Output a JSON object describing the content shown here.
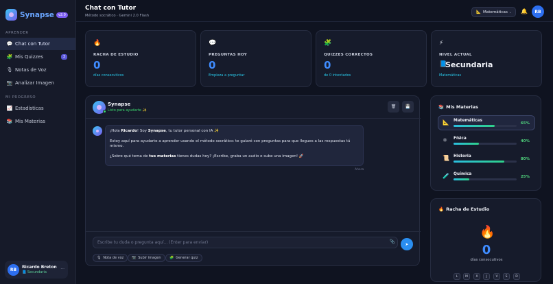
{
  "app": {
    "name": "Synapse",
    "version": "v2.0"
  },
  "sidebar": {
    "section_learn": "APRENDER",
    "section_progress": "MI PROGRESO",
    "items": [
      {
        "label": "Chat con Tutor",
        "icon": "chat-icon"
      },
      {
        "label": "Mis Quizzes",
        "icon": "quiz-icon",
        "badge": "3"
      },
      {
        "label": "Notas de Voz",
        "icon": "mic-icon"
      },
      {
        "label": "Analizar Imagen",
        "icon": "image-icon"
      },
      {
        "label": "Estadísticas",
        "icon": "chart-icon"
      },
      {
        "label": "Mis Materias",
        "icon": "books-icon"
      }
    ],
    "user": {
      "initials": "RB",
      "name": "Ricardo Breton",
      "level": "Secundaria"
    }
  },
  "header": {
    "title": "Chat con Tutor",
    "subtitle": "Método socrático · Gemini 2.0 Flash",
    "subject": "Matemáticas",
    "avatar": "RB"
  },
  "stats": [
    {
      "label": "RACHA DE ESTUDIO",
      "value": "0",
      "foot": "días consecutivos",
      "icon": "fire-icon"
    },
    {
      "label": "PREGUNTAS HOY",
      "value": "0",
      "foot": "Empieza a preguntar",
      "icon": "speech-icon"
    },
    {
      "label": "QUIZZES CORRECTOS",
      "value": "0",
      "foot": "de 0 intentados",
      "icon": "puzzle-icon"
    },
    {
      "label": "NIVEL ACTUAL",
      "value": "Secundaria",
      "foot": "Matemáticas",
      "icon": "bolt-icon"
    }
  ],
  "chat": {
    "bot_name": "Synapse",
    "bot_status": "Listo para ayudarte ✨",
    "message": {
      "p1_a": "¡Hola ",
      "p1_b": "Ricardo",
      "p1_c": "! Soy ",
      "p1_d": "Synapse",
      "p1_e": ", tu tutor personal con IA ✨",
      "p2": "Estoy aquí para ayudarte a aprender usando el método socrático: te guiaré con preguntas para que llegues a las respuestas tú mismo.",
      "p3_a": "¿Sobre qué tema de ",
      "p3_b": "tus materias",
      "p3_c": " tienes dudas hoy? ¡Escribe, graba un audio o sube una imagen! 🚀",
      "time": "Ahora"
    },
    "input_placeholder": "Escribe tu duda o pregunta aquí... (Enter para enviar)",
    "actions": [
      "Nota de voz",
      "Subir imagen",
      "Generar quiz"
    ]
  },
  "materias": {
    "title": "Mis Materias",
    "items": [
      {
        "name": "Matemáticas",
        "percent": 65,
        "label": "65%",
        "icon": "ruler-icon"
      },
      {
        "name": "Física",
        "percent": 40,
        "label": "40%",
        "icon": "atom-icon"
      },
      {
        "name": "Historia",
        "percent": 80,
        "label": "80%",
        "icon": "scroll-icon"
      },
      {
        "name": "Química",
        "percent": 25,
        "label": "25%",
        "icon": "flask-icon"
      }
    ]
  },
  "racha": {
    "title": "Racha de Estudio",
    "value": "0",
    "caption": "días consecutivos",
    "days": [
      "L",
      "M",
      "X",
      "J",
      "V",
      "S",
      "D"
    ]
  }
}
